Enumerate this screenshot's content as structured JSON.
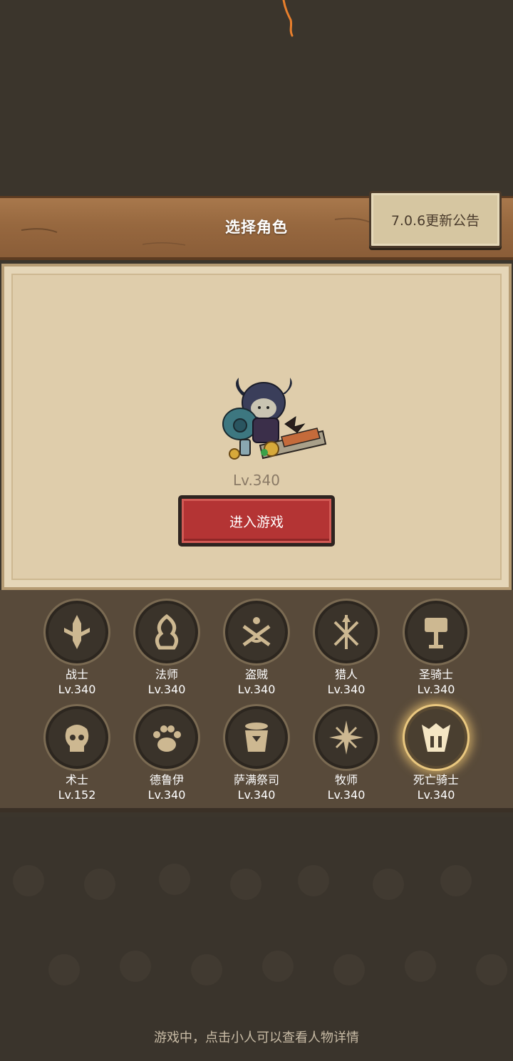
{
  "header": {
    "title": "选择角色",
    "notice_button": "7.0.6更新公告"
  },
  "hero": {
    "level": "Lv.340"
  },
  "enter_button": "进入游戏",
  "classes": [
    {
      "name": "战士",
      "level": "Lv.340",
      "icon": "warrior-icon"
    },
    {
      "name": "法师",
      "level": "Lv.340",
      "icon": "mage-icon"
    },
    {
      "name": "盗贼",
      "level": "Lv.340",
      "icon": "rogue-icon"
    },
    {
      "name": "猎人",
      "level": "Lv.340",
      "icon": "hunter-icon"
    },
    {
      "name": "圣骑士",
      "level": "Lv.340",
      "icon": "paladin-icon"
    },
    {
      "name": "术士",
      "level": "Lv.152",
      "icon": "warlock-icon"
    },
    {
      "name": "德鲁伊",
      "level": "Lv.340",
      "icon": "druid-icon"
    },
    {
      "name": "萨满祭司",
      "level": "Lv.340",
      "icon": "shaman-icon"
    },
    {
      "name": "牧师",
      "level": "Lv.340",
      "icon": "priest-icon"
    },
    {
      "name": "死亡骑士",
      "level": "Lv.340",
      "icon": "death-knight-icon",
      "selected": true
    }
  ],
  "tip": "游戏中，点击小人可以查看人物详情",
  "colors": {
    "accent_red": "#b43434",
    "gold": "#e9c77f",
    "panel": "#584a3a"
  }
}
